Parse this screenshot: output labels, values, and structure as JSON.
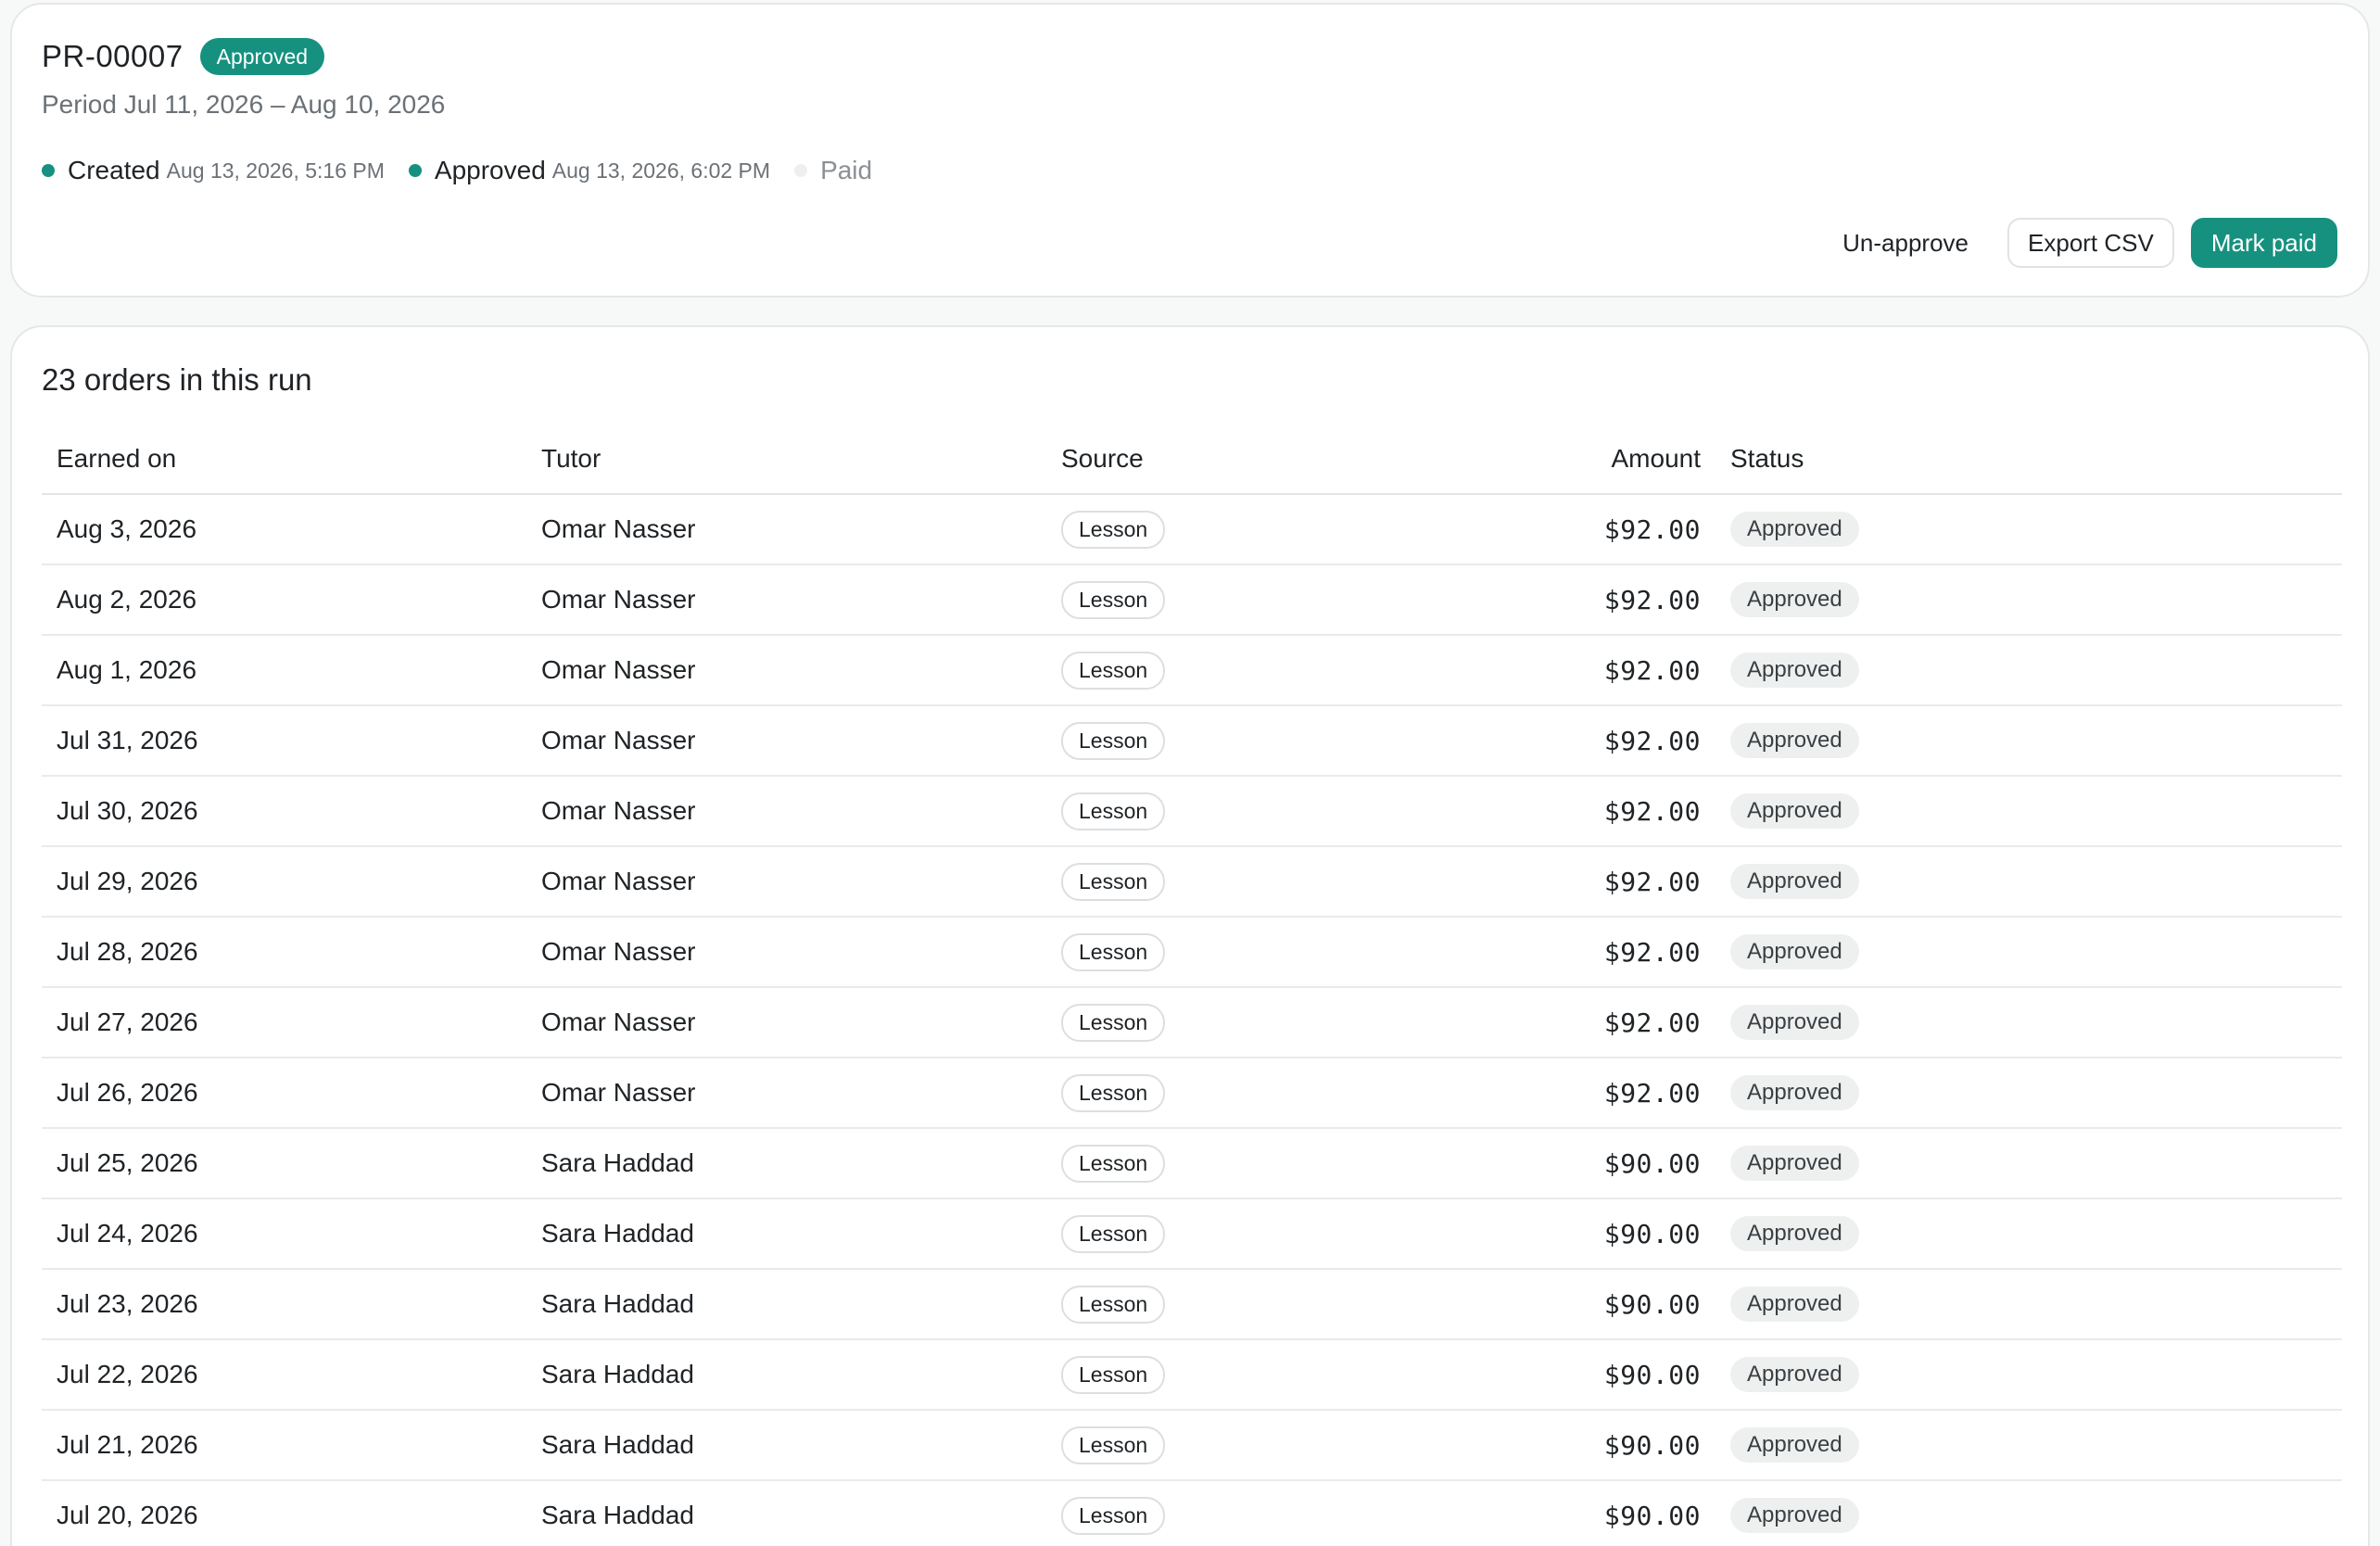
{
  "header": {
    "run_id": "PR-00007",
    "status_badge": "Approved",
    "period": "Period Jul 11, 2026 – Aug 10, 2026",
    "timeline": [
      {
        "label": "Created",
        "time": "Aug 13, 2026, 5:16 PM",
        "done": true
      },
      {
        "label": "Approved",
        "time": "Aug 13, 2026, 6:02 PM",
        "done": true
      },
      {
        "label": "Paid",
        "time": "",
        "done": false
      }
    ],
    "actions": {
      "unapprove": "Un-approve",
      "export": "Export CSV",
      "mark_paid": "Mark paid"
    }
  },
  "orders": {
    "title": "23 orders in this run",
    "columns": {
      "earned_on": "Earned on",
      "tutor": "Tutor",
      "source": "Source",
      "amount": "Amount",
      "status": "Status"
    },
    "rows": [
      {
        "date": "Aug 3, 2026",
        "tutor": "Omar Nasser",
        "source": "Lesson",
        "amount": "$92.00",
        "status": "Approved"
      },
      {
        "date": "Aug 2, 2026",
        "tutor": "Omar Nasser",
        "source": "Lesson",
        "amount": "$92.00",
        "status": "Approved"
      },
      {
        "date": "Aug 1, 2026",
        "tutor": "Omar Nasser",
        "source": "Lesson",
        "amount": "$92.00",
        "status": "Approved"
      },
      {
        "date": "Jul 31, 2026",
        "tutor": "Omar Nasser",
        "source": "Lesson",
        "amount": "$92.00",
        "status": "Approved"
      },
      {
        "date": "Jul 30, 2026",
        "tutor": "Omar Nasser",
        "source": "Lesson",
        "amount": "$92.00",
        "status": "Approved"
      },
      {
        "date": "Jul 29, 2026",
        "tutor": "Omar Nasser",
        "source": "Lesson",
        "amount": "$92.00",
        "status": "Approved"
      },
      {
        "date": "Jul 28, 2026",
        "tutor": "Omar Nasser",
        "source": "Lesson",
        "amount": "$92.00",
        "status": "Approved"
      },
      {
        "date": "Jul 27, 2026",
        "tutor": "Omar Nasser",
        "source": "Lesson",
        "amount": "$92.00",
        "status": "Approved"
      },
      {
        "date": "Jul 26, 2026",
        "tutor": "Omar Nasser",
        "source": "Lesson",
        "amount": "$92.00",
        "status": "Approved"
      },
      {
        "date": "Jul 25, 2026",
        "tutor": "Sara Haddad",
        "source": "Lesson",
        "amount": "$90.00",
        "status": "Approved"
      },
      {
        "date": "Jul 24, 2026",
        "tutor": "Sara Haddad",
        "source": "Lesson",
        "amount": "$90.00",
        "status": "Approved"
      },
      {
        "date": "Jul 23, 2026",
        "tutor": "Sara Haddad",
        "source": "Lesson",
        "amount": "$90.00",
        "status": "Approved"
      },
      {
        "date": "Jul 22, 2026",
        "tutor": "Sara Haddad",
        "source": "Lesson",
        "amount": "$90.00",
        "status": "Approved"
      },
      {
        "date": "Jul 21, 2026",
        "tutor": "Sara Haddad",
        "source": "Lesson",
        "amount": "$90.00",
        "status": "Approved"
      },
      {
        "date": "Jul 20, 2026",
        "tutor": "Sara Haddad",
        "source": "Lesson",
        "amount": "$90.00",
        "status": "Approved"
      }
    ]
  },
  "colors": {
    "accent": "#16917f",
    "border": "#e5e8e8",
    "muted_text": "#6b7176"
  }
}
